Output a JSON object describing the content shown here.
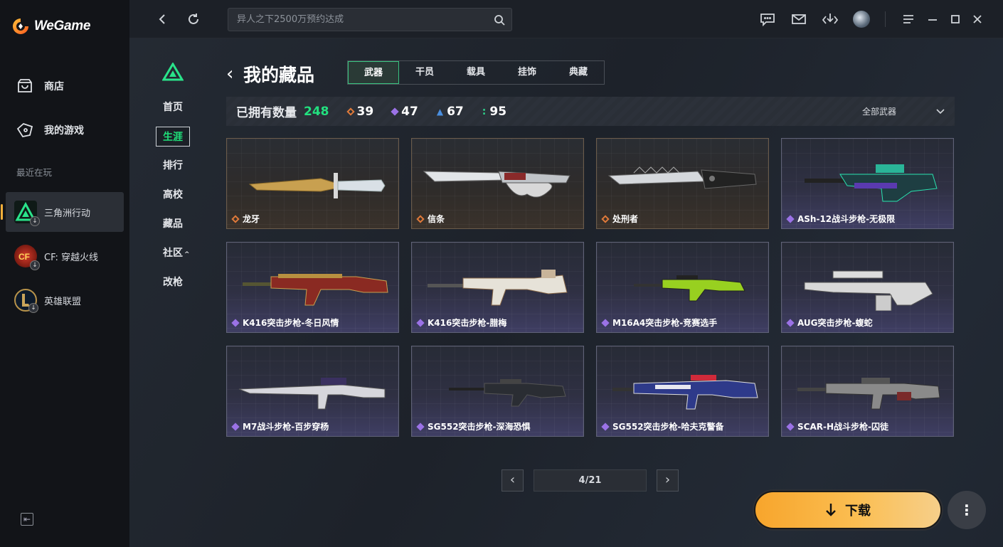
{
  "app": {
    "name": "WeGame"
  },
  "sidebar": {
    "nav": [
      {
        "label": "商店",
        "icon": "store-bag-icon"
      },
      {
        "label": "我的游戏",
        "icon": "gamepad-icon"
      }
    ],
    "recent_label": "最近在玩",
    "recent_games": [
      {
        "label": "三角洲行动",
        "icon": "delta-force-icon",
        "active": true
      },
      {
        "label": "CF: 穿越火线",
        "icon": "crossfire-icon",
        "active": false
      },
      {
        "label": "英雄联盟",
        "icon": "league-of-legends-icon",
        "active": false
      }
    ]
  },
  "topbar": {
    "search_placeholder": "异人之下2500万预约达成"
  },
  "subnav": {
    "items": [
      "首页",
      "生涯",
      "排行",
      "高校",
      "藏品",
      "社区",
      "改枪"
    ],
    "active": "生涯"
  },
  "collection": {
    "back_label": "‹",
    "title": "我的藏品",
    "tabs": [
      "武器",
      "干员",
      "载具",
      "挂饰",
      "典藏"
    ],
    "active_tab": "武器",
    "owned_label": "已拥有数量",
    "owned_count": "248",
    "rarity_counts": [
      {
        "value": "39",
        "color": "#e07a3a"
      },
      {
        "value": "47",
        "color": "#9b72e6"
      },
      {
        "value": "67",
        "color": "#4a8fe0"
      },
      {
        "value": "95",
        "color": "#2fcf8a"
      }
    ],
    "filter_label": "全部武器",
    "items": [
      {
        "name": "龙牙",
        "rarity": "gold",
        "weapon": "knife-gold"
      },
      {
        "name": "信条",
        "rarity": "gold",
        "weapon": "knife-knuckle"
      },
      {
        "name": "处刑者",
        "rarity": "gold",
        "weapon": "knife-saw"
      },
      {
        "name": "ASh-12战斗步枪-无极限",
        "rarity": "purple",
        "weapon": "rifle-bullpup"
      },
      {
        "name": "K416突击步枪-冬日风情",
        "rarity": "purple",
        "weapon": "rifle-red"
      },
      {
        "name": "K416突击步枪-腊梅",
        "rarity": "purple",
        "weapon": "rifle-white"
      },
      {
        "name": "M16A4突击步枪-竞赛选手",
        "rarity": "purple",
        "weapon": "rifle-lime"
      },
      {
        "name": "AUG突击步枪-蝮蛇",
        "rarity": "purple",
        "weapon": "rifle-aug"
      },
      {
        "name": "M7战斗步枪-百步穿杨",
        "rarity": "purple",
        "weapon": "rifle-m7"
      },
      {
        "name": "SG552突击步枪-深海恐惧",
        "rarity": "purple",
        "weapon": "rifle-dark"
      },
      {
        "name": "SG552突击步枪-哈夫克警备",
        "rarity": "purple",
        "weapon": "rifle-blue"
      },
      {
        "name": "SCAR-H战斗步枪-囚徒",
        "rarity": "purple",
        "weapon": "rifle-scar"
      }
    ]
  },
  "pagination": {
    "current": "4/21"
  },
  "download": {
    "label": "下载"
  },
  "colors": {
    "accent_green": "#22e07f",
    "download_orange": "#f7a52c",
    "gold_rarity": "#e07a3a",
    "purple_rarity": "#9b72e6"
  }
}
